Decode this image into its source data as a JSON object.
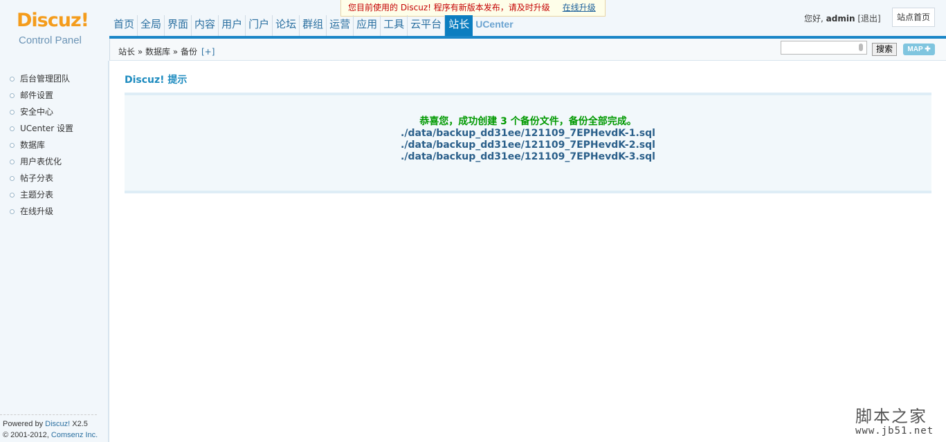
{
  "header": {
    "logo_brand": "Discuz!",
    "logo_sub": "Control Panel",
    "notice_text": "您目前使用的 Discuz! 程序有新版本发布，请及时升级",
    "notice_link": "在线升级",
    "greeting": "您好,",
    "username": "admin",
    "logout": "[退出]",
    "site_home": "站点首页"
  },
  "nav": {
    "items": [
      "首页",
      "全局",
      "界面",
      "内容",
      "用户",
      "门户",
      "论坛",
      "群组",
      "运营",
      "应用",
      "工具",
      "云平台",
      "站长",
      "UCenter"
    ],
    "active": "站长"
  },
  "breadcrumb": {
    "path": "站长 » 数据库 » 备份",
    "add": "[+]"
  },
  "search": {
    "value": "",
    "button": "搜索",
    "map": "MAP ✚"
  },
  "sidebar": {
    "items": [
      "后台管理团队",
      "邮件设置",
      "安全中心",
      "UCenter 设置",
      "数据库",
      "用户表优化",
      "帖子分表",
      "主题分表",
      "在线升级"
    ]
  },
  "main": {
    "title": "Discuz! 提示",
    "message": "恭喜您，成功创建 3 个备份文件，备份全部完成。",
    "files": [
      "./data/backup_dd31ee/121109_7EPHevdK-1.sql",
      "./data/backup_dd31ee/121109_7EPHevdK-2.sql",
      "./data/backup_dd31ee/121109_7EPHevdK-3.sql"
    ]
  },
  "footer": {
    "powered_prefix": "Powered by ",
    "powered_link": "Discuz!",
    "version": " X2.5",
    "copyright_prefix": "© 2001-2012, ",
    "copyright_link": "Comsenz Inc."
  },
  "watermark": {
    "text": "脚本之家",
    "url": "www.jb51.net"
  },
  "colors": {
    "brand": "#f49c1c",
    "nav_active": "#0b7ec0",
    "success": "#009900"
  }
}
